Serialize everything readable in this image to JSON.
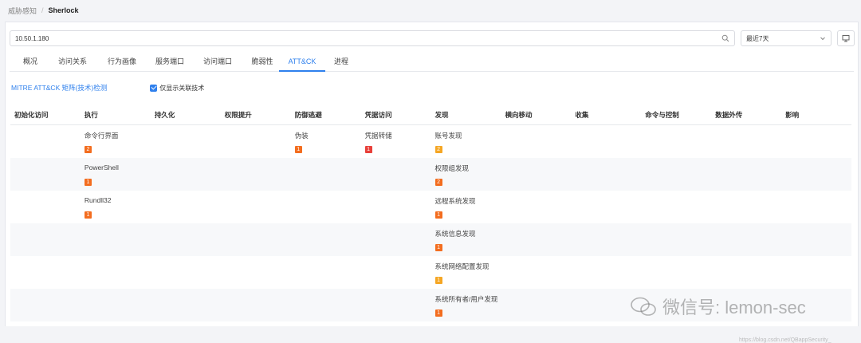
{
  "breadcrumb": {
    "parent": "威胁感知",
    "sep": "/",
    "current": "Sherlock"
  },
  "search": {
    "value": "10.50.1.180"
  },
  "range": {
    "selected": "最近7天"
  },
  "tabs": [
    "概况",
    "访问关系",
    "行为画像",
    "服务端口",
    "访问端口",
    "脆弱性",
    "ATT&CK",
    "进程"
  ],
  "active_tab": "ATT&CK",
  "options": {
    "matrix_link": "MITRE ATT&CK 矩阵(技术)检测",
    "only_related_label": "仅显示关联技术",
    "only_related_checked": true
  },
  "columns": [
    "初始化访问",
    "执行",
    "持久化",
    "权限提升",
    "防御逃避",
    "凭据访问",
    "发现",
    "横向移动",
    "收集",
    "命令与控制",
    "数据外传",
    "影响"
  ],
  "rows": [
    {
      "cells": [
        null,
        {
          "name": "命令行界面",
          "count": "2",
          "level": "high"
        },
        null,
        null,
        {
          "name": "伪装",
          "count": "1",
          "level": "high"
        },
        {
          "name": "凭据转储",
          "count": "1",
          "level": "critical"
        },
        {
          "name": "账号发现",
          "count": "2",
          "level": "medium"
        },
        null,
        null,
        null,
        null,
        null
      ]
    },
    {
      "cells": [
        null,
        {
          "name": "PowerShell",
          "count": "1",
          "level": "high"
        },
        null,
        null,
        null,
        null,
        {
          "name": "权限组发现",
          "count": "2",
          "level": "high"
        },
        null,
        null,
        null,
        null,
        null
      ]
    },
    {
      "cells": [
        null,
        {
          "name": "Rundll32",
          "count": "1",
          "level": "high"
        },
        null,
        null,
        null,
        null,
        {
          "name": "远程系统发现",
          "count": "1",
          "level": "high"
        },
        null,
        null,
        null,
        null,
        null
      ]
    },
    {
      "cells": [
        null,
        null,
        null,
        null,
        null,
        null,
        {
          "name": "系统信息发现",
          "count": "1",
          "level": "high"
        },
        null,
        null,
        null,
        null,
        null
      ]
    },
    {
      "cells": [
        null,
        null,
        null,
        null,
        null,
        null,
        {
          "name": "系统网络配置发现",
          "count": "1",
          "level": "medium"
        },
        null,
        null,
        null,
        null,
        null
      ]
    },
    {
      "cells": [
        null,
        null,
        null,
        null,
        null,
        null,
        {
          "name": "系统所有者/用户发现",
          "count": "1",
          "level": "high"
        },
        null,
        null,
        null,
        null,
        null
      ]
    }
  ],
  "level_colors": {
    "high": "#f36d1f",
    "medium": "#f5a623",
    "critical": "#e8403a"
  },
  "watermark": {
    "text": "微信号: lemon-sec",
    "url": "https://blog.csdn.net/QBappSecurity_"
  }
}
